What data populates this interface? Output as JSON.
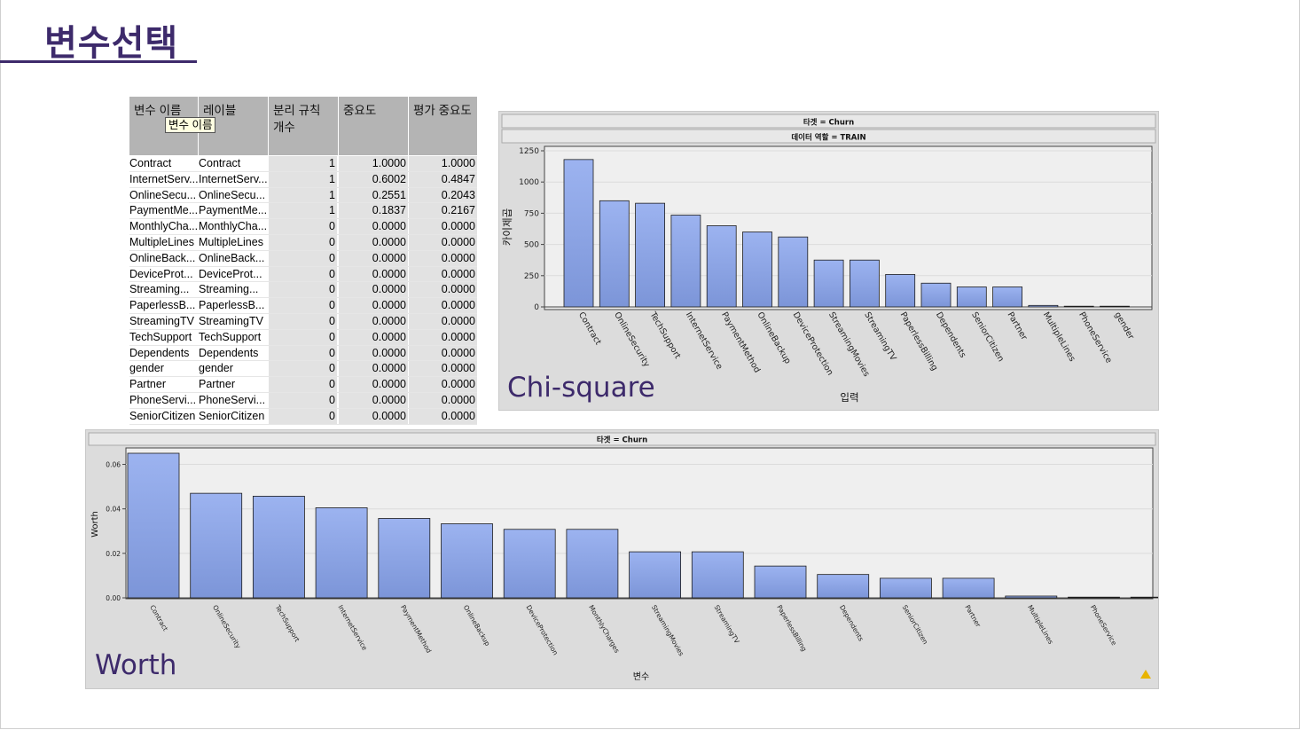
{
  "slide": {
    "title": "변수선택"
  },
  "table": {
    "headers": [
      "변수 이름",
      "레이블",
      "분리 규칙\n개수",
      "중요도",
      "평가 중요도"
    ],
    "tooltip": "변수 이름",
    "rows": [
      [
        "Contract",
        "Contract",
        "1",
        "1.0000",
        "1.0000"
      ],
      [
        "InternetServ...",
        "InternetServ...",
        "1",
        "0.6002",
        "0.4847"
      ],
      [
        "OnlineSecu...",
        "OnlineSecu...",
        "1",
        "0.2551",
        "0.2043"
      ],
      [
        "PaymentMe...",
        "PaymentMe...",
        "1",
        "0.1837",
        "0.2167"
      ],
      [
        "MonthlyCha...",
        "MonthlyCha...",
        "0",
        "0.0000",
        "0.0000"
      ],
      [
        "MultipleLines",
        "MultipleLines",
        "0",
        "0.0000",
        "0.0000"
      ],
      [
        "OnlineBack...",
        "OnlineBack...",
        "0",
        "0.0000",
        "0.0000"
      ],
      [
        "DeviceProt...",
        "DeviceProt...",
        "0",
        "0.0000",
        "0.0000"
      ],
      [
        "Streaming...",
        "Streaming...",
        "0",
        "0.0000",
        "0.0000"
      ],
      [
        "PaperlessB...",
        "PaperlessB...",
        "0",
        "0.0000",
        "0.0000"
      ],
      [
        "StreamingTV",
        "StreamingTV",
        "0",
        "0.0000",
        "0.0000"
      ],
      [
        "TechSupport",
        "TechSupport",
        "0",
        "0.0000",
        "0.0000"
      ],
      [
        "Dependents",
        "Dependents",
        "0",
        "0.0000",
        "0.0000"
      ],
      [
        "gender",
        "gender",
        "0",
        "0.0000",
        "0.0000"
      ],
      [
        "Partner",
        "Partner",
        "0",
        "0.0000",
        "0.0000"
      ],
      [
        "PhoneServi...",
        "PhoneServi...",
        "0",
        "0.0000",
        "0.0000"
      ],
      [
        "SeniorCitizen",
        "SeniorCitizen",
        "0",
        "0.0000",
        "0.0000"
      ]
    ]
  },
  "chi_label": "Chi-square",
  "worth_label": "Worth",
  "colors": {
    "bar_top": "#9cb3f0",
    "bar_bottom": "#7c95d8",
    "title": "#3d2a6b",
    "panel": "#dcdcdc"
  },
  "chart_data": [
    {
      "type": "bar",
      "header1": "타겟 = Churn",
      "header2": "데이터 역할 = TRAIN",
      "xlabel": "입력",
      "ylabel": "카이제곱",
      "ylim": [
        0,
        1250
      ],
      "yticks": [
        0,
        250,
        500,
        750,
        1000,
        1250
      ],
      "grid": true,
      "categories": [
        "Contract",
        "OnlineSecurity",
        "TechSupport",
        "InternetService",
        "PaymentMethod",
        "OnlineBackup",
        "DeviceProtection",
        "StreamingMovies",
        "StreamingTV",
        "PaperlessBilling",
        "Dependents",
        "SeniorCitizen",
        "Partner",
        "MultipleLines",
        "PhoneService",
        "gender"
      ],
      "values": [
        1180,
        850,
        830,
        735,
        650,
        600,
        560,
        375,
        375,
        260,
        190,
        160,
        160,
        12,
        2,
        2
      ]
    },
    {
      "type": "bar",
      "header1": "타겟 = Churn",
      "xlabel": "변수",
      "ylabel": "Worth",
      "ylim": [
        0,
        0.065
      ],
      "yticks": [
        "0.00",
        "0.02",
        "0.04",
        "0.06"
      ],
      "grid": true,
      "categories": [
        "Contract",
        "OnlineSecurity",
        "TechSupport",
        "InternetService",
        "PaymentMethod",
        "OnlineBackup",
        "DeviceProtection",
        "MonthlyCharges",
        "StreamingMovies",
        "StreamingTV",
        "PaperlessBilling",
        "Dependents",
        "SeniorCitizen",
        "Partner",
        "MultipleLines",
        "PhoneService",
        ""
      ],
      "values": [
        0.065,
        0.047,
        0.0457,
        0.0405,
        0.0357,
        0.0333,
        0.0308,
        0.0308,
        0.0207,
        0.0207,
        0.0143,
        0.0105,
        0.0088,
        0.0088,
        0.0008,
        0.0003,
        0.0003
      ]
    }
  ]
}
